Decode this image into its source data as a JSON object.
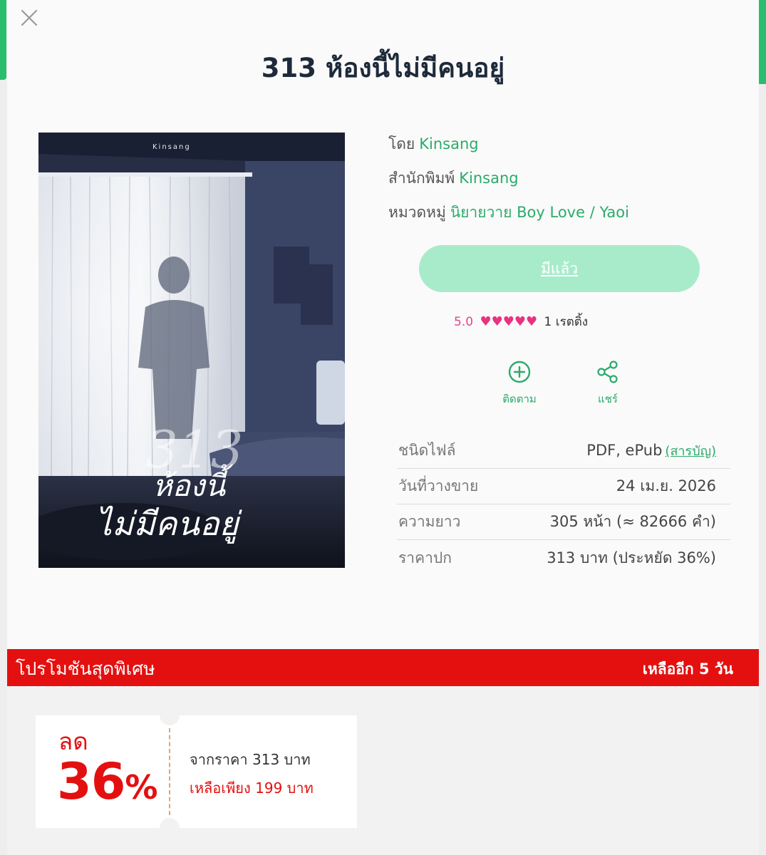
{
  "book": {
    "title": "313 ห้องนี้ไม่มีคนอยู่",
    "cover": {
      "author_mark": "Kinsang",
      "title_line1": "313",
      "title_line2": "ห้องนี้",
      "title_line3": "ไม่มีคนอยู่"
    }
  },
  "meta": {
    "author_label": "โดย",
    "author": "Kinsang",
    "publisher_label": "สำนักพิมพ์",
    "publisher": "Kinsang",
    "category_label": "หมวดหมู่",
    "category": "นิยายวาย Boy Love / Yaoi"
  },
  "owned_button": "มีแล้ว",
  "rating": {
    "score": "5.0",
    "hearts": "♥♥♥♥♥",
    "count": "1 เรตติ้ง",
    "value": 5,
    "max": 5
  },
  "actions": {
    "follow": "ติดตาม",
    "share": "แชร์"
  },
  "details": [
    {
      "key": "ชนิดไฟล์",
      "value": "PDF, ePub",
      "link": "(สารบัญ)"
    },
    {
      "key": "วันที่วางขาย",
      "value": "24 เม.ย. 2026"
    },
    {
      "key": "ความยาว",
      "value": "305  หน้า (≈ 82666 คำ)"
    },
    {
      "key": "ราคาปก",
      "value": "313 บาท (ประหยัด 36%)"
    }
  ],
  "promo": {
    "title": "โปรโมชันสุดพิเศษ",
    "remaining": "เหลืออีก 5 วัน",
    "discount_label": "ลด",
    "discount_value": "36",
    "percent_sign": "%",
    "from_price": "จากราคา 313 บาท",
    "now_price": "เหลือเพียง 199 บาท"
  },
  "colors": {
    "brand_green": "#2bab6b",
    "owned_button_bg": "#a8ebcb",
    "promo_red": "#e41010",
    "heart_pink": "#e8337e"
  }
}
